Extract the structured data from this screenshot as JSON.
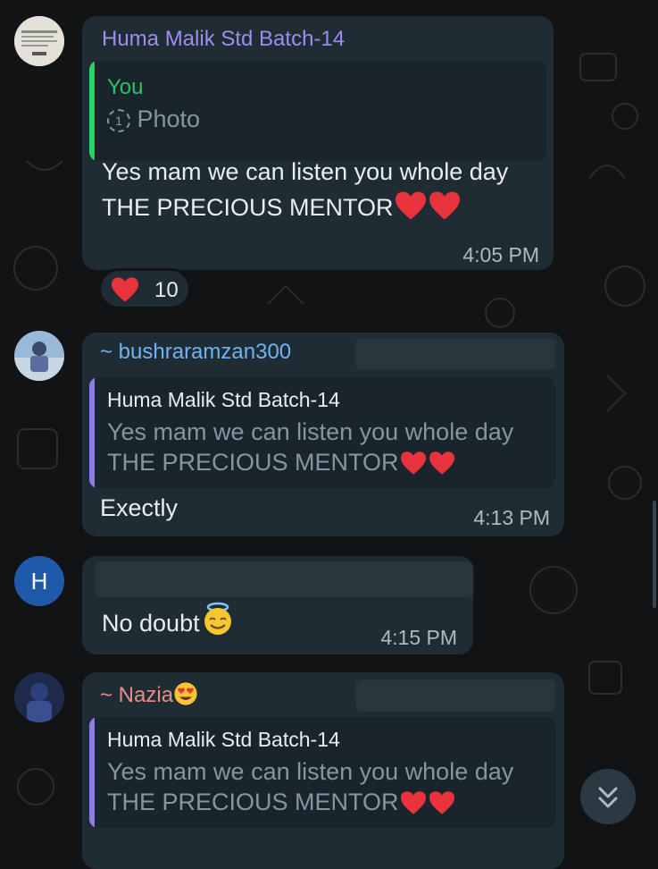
{
  "messages": [
    {
      "sender": "Huma Malik Std Batch-14",
      "quote": {
        "name": "You",
        "label": "Photo"
      },
      "text_line1": "Yes mam we can listen you whole day",
      "text_line2": "THE PRECIOUS MENTOR",
      "time": "4:05 PM",
      "reaction": {
        "icon": "heart-icon",
        "count": "10"
      }
    },
    {
      "sender": "~ bushraramzan300",
      "quote": {
        "name": "Huma Malik Std Batch-14",
        "line1": "Yes mam we can listen you whole day",
        "line2": "THE PRECIOUS MENTOR"
      },
      "text": "Exectly",
      "time": "4:13 PM"
    },
    {
      "avatar_letter": "H",
      "text": "No doubt",
      "time": "4:15 PM"
    },
    {
      "sender": "~ Nazia",
      "quote": {
        "name": "Huma Malik Std Batch-14",
        "line1": "Yes mam we can listen you whole day",
        "line2": "THE PRECIOUS MENTOR"
      }
    }
  ],
  "colors": {
    "sender1": "#9e8cf0",
    "sender2": "#6fb3f5",
    "sender4": "#f08a8a",
    "quote_you_bar": "#25d366",
    "quote_you_name": "#2ebf6e",
    "quote_other_bar": "#8f7be8",
    "avatar_h_bg": "#1e5aa8"
  }
}
